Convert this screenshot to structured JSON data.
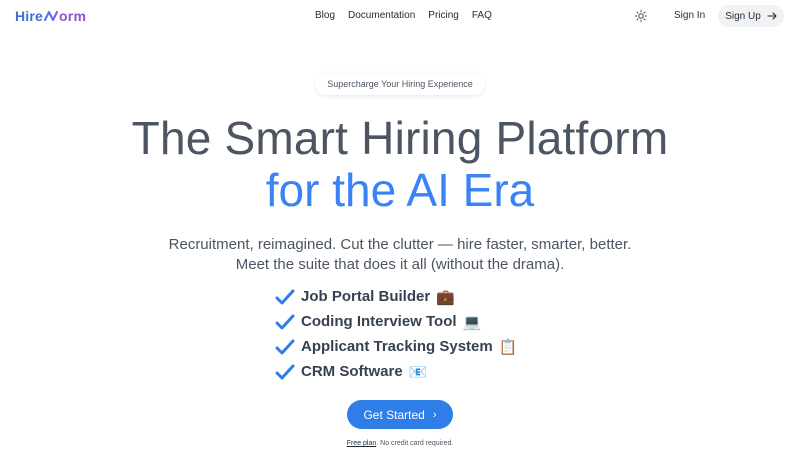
{
  "brand": {
    "name_part1": "Hire",
    "name_part2": "orm",
    "primary_color": "#3b82f6",
    "accent_color": "#8a55c9"
  },
  "nav": {
    "items": [
      "Blog",
      "Documentation",
      "Pricing",
      "FAQ"
    ]
  },
  "header": {
    "theme_icon": "sun-icon",
    "sign_in": "Sign In",
    "sign_up": "Sign Up",
    "sign_up_icon": "arrow-right-icon"
  },
  "hero": {
    "badge": "Supercharge Your Hiring Experience",
    "title_line1": "The Smart Hiring Platform",
    "title_line2": "for the AI Era",
    "subtitle_line1": "Recruitment, reimagined. Cut the clutter — hire faster, smarter, better.",
    "subtitle_line2": "Meet the suite that does it all (without the drama).",
    "features": [
      {
        "label": "Job Portal Builder",
        "emoji": "💼"
      },
      {
        "label": "Coding Interview Tool",
        "emoji": "💻"
      },
      {
        "label": "Applicant Tracking System",
        "emoji": "📋"
      },
      {
        "label": "CRM Software",
        "emoji": "📧"
      }
    ],
    "cta": "Get Started",
    "note_link": "Free plan",
    "note_text": ". No credit card required."
  }
}
